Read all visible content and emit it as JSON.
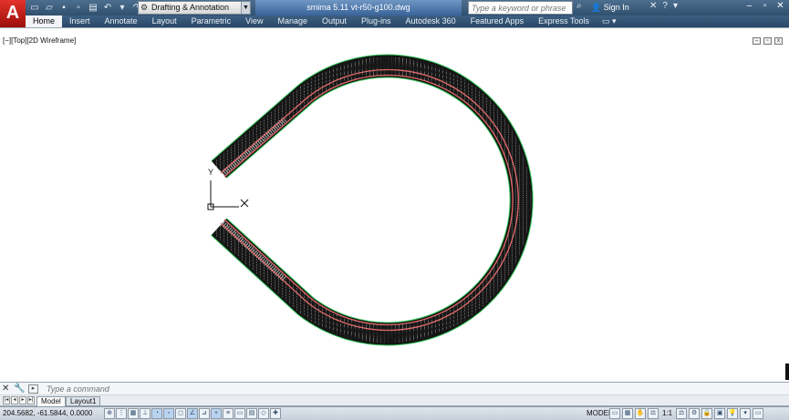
{
  "app": {
    "logo_letter": "A",
    "window_title": "smima 5.11 vt-r50-g100.dwg"
  },
  "titlebar": {
    "workspace": "Drafting & Annotation",
    "search_placeholder": "Type a keyword or phrase",
    "signin": "Sign In"
  },
  "ribbon_tabs": [
    "Home",
    "Insert",
    "Annotate",
    "Layout",
    "Parametric",
    "View",
    "Manage",
    "Output",
    "Plug-ins",
    "Autodesk 360",
    "Featured Apps",
    "Express Tools"
  ],
  "ribbon_active": "Home",
  "viewport": {
    "label": "[−][Top][2D Wireframe]",
    "ucs_y_label": "Y",
    "ucs_x_label": "X"
  },
  "command": {
    "placeholder": "Type a command"
  },
  "layout_tabs": [
    "Model",
    "Layout1"
  ],
  "status": {
    "coordinates": "204.5682, -61.5844, 0.0000",
    "model": "MODEL",
    "scale": "1:1"
  },
  "icons": {
    "close": "close-icon",
    "wrench": "wrench-icon",
    "gear": "gear-icon",
    "search": "search-icon",
    "user": "user-icon"
  },
  "colors": {
    "track_body": "#111111",
    "rail_line": "#e26b6b",
    "outline": "#34c759",
    "title_bar": "#3d5f81"
  }
}
